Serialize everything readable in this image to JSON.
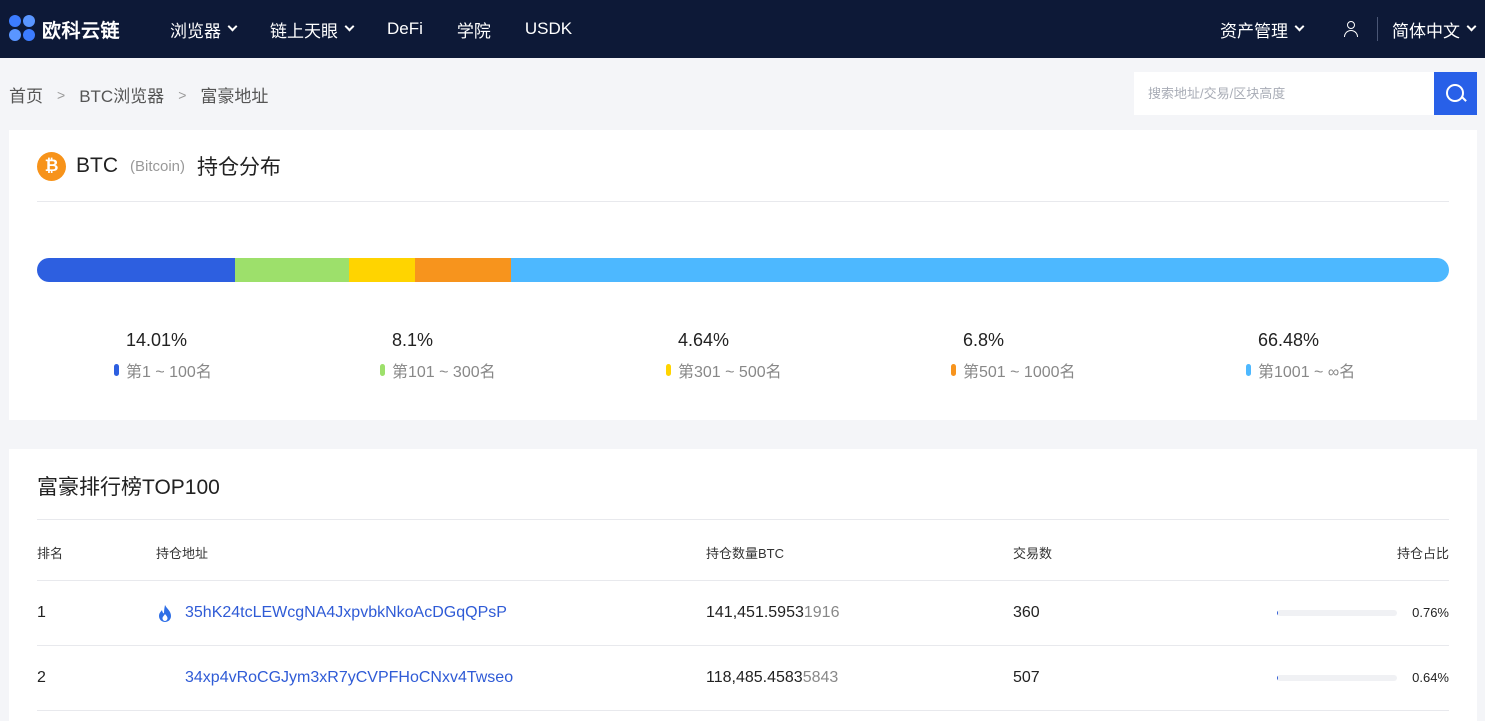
{
  "nav": {
    "logo_text": "欧科云链",
    "menu": [
      {
        "label": "浏览器",
        "dropdown": true
      },
      {
        "label": "链上天眼",
        "dropdown": true
      },
      {
        "label": "DeFi",
        "dropdown": false
      },
      {
        "label": "学院",
        "dropdown": false
      },
      {
        "label": "USDK",
        "dropdown": false
      }
    ],
    "asset_mgmt": "资产管理",
    "language": "简体中文"
  },
  "breadcrumb": [
    "首页",
    "BTC浏览器",
    "富豪地址"
  ],
  "search": {
    "placeholder": "搜索地址/交易/区块高度"
  },
  "coin": {
    "icon": "₿",
    "symbol": "BTC",
    "full_name": "(Bitcoin)",
    "title": "持仓分布"
  },
  "distribution": [
    {
      "pct": "14.01%",
      "label": "第1 ~ 100名",
      "color": "#2d5fe0",
      "value": 14.01
    },
    {
      "pct": "8.1%",
      "label": "第101 ~ 300名",
      "color": "#9de06b",
      "value": 8.1
    },
    {
      "pct": "4.64%",
      "label": "第301 ~ 500名",
      "color": "#ffd400",
      "value": 4.64
    },
    {
      "pct": "6.8%",
      "label": "第501 ~ 1000名",
      "color": "#f7941d",
      "value": 6.8
    },
    {
      "pct": "66.48%",
      "label": "第1001 ~ ∞名",
      "color": "#4db8ff",
      "value": 66.48
    }
  ],
  "ranking": {
    "title": "富豪排行榜TOP100",
    "columns": [
      "排名",
      "持仓地址",
      "持仓数量BTC",
      "交易数",
      "持仓占比"
    ],
    "rows": [
      {
        "rank": "1",
        "address": "35hK24tcLEWcgNA4JxpvbkNkoAcDGqQPsP",
        "has_icon": true,
        "amount_main": "141,451.5953",
        "amount_rest": "1916",
        "tx": "360",
        "share": "0.76%",
        "share_value": 0.76
      },
      {
        "rank": "2",
        "address": "34xp4vRoCGJym3xR7yCVPFHoCNxv4Twseo",
        "has_icon": false,
        "amount_main": "118,485.4583",
        "amount_rest": "5843",
        "tx": "507",
        "share": "0.64%",
        "share_value": 0.64
      }
    ]
  }
}
